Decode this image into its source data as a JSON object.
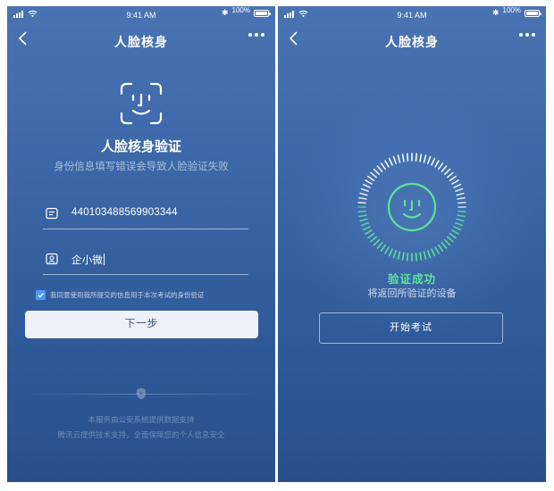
{
  "colors": {
    "background_top": "#4a73b3",
    "background_bottom": "#284f8c",
    "accent_blue": "#4a9af5",
    "success_green": "#5fe29a",
    "button_bg": "#eef1f7",
    "button_text": "#34598f"
  },
  "left_screen": {
    "status": {
      "time": "9:41 AM",
      "battery_percent": "100%",
      "battery_level": 1.0
    },
    "nav": {
      "back_icon": "chevron-left-icon",
      "title": "人脸核身",
      "more_icon": "more-dots-icon"
    },
    "face_icon": "face-id-icon",
    "heading": "人脸核身验证",
    "subheading": "身份信息填写错误会导致人脸验证失败",
    "id_field": {
      "icon": "id-card-icon",
      "value": "440103488569903344"
    },
    "name_field": {
      "icon": "person-icon",
      "value": "企小微"
    },
    "agreement": {
      "checked": true,
      "text": "我同意使用我所提交的信息用于本次考试的身份验证"
    },
    "next_button": "下一步",
    "footer": {
      "icon": "shield-icon",
      "line1": "本服务由公安系统提供数据支持",
      "line2": "腾讯云提供技术支持，全面保障您的个人信息安全"
    }
  },
  "right_screen": {
    "status": {
      "time": "9:41 AM",
      "battery_percent": "100%",
      "battery_level": 1.0
    },
    "nav": {
      "back_icon": "chevron-left-icon",
      "title": "人脸核身",
      "more_icon": "more-dots-icon"
    },
    "result_icon": "smile-face-icon",
    "result_text": "验证成功",
    "return_text": "将返回所验证的设备",
    "start_button": "开始考试"
  }
}
